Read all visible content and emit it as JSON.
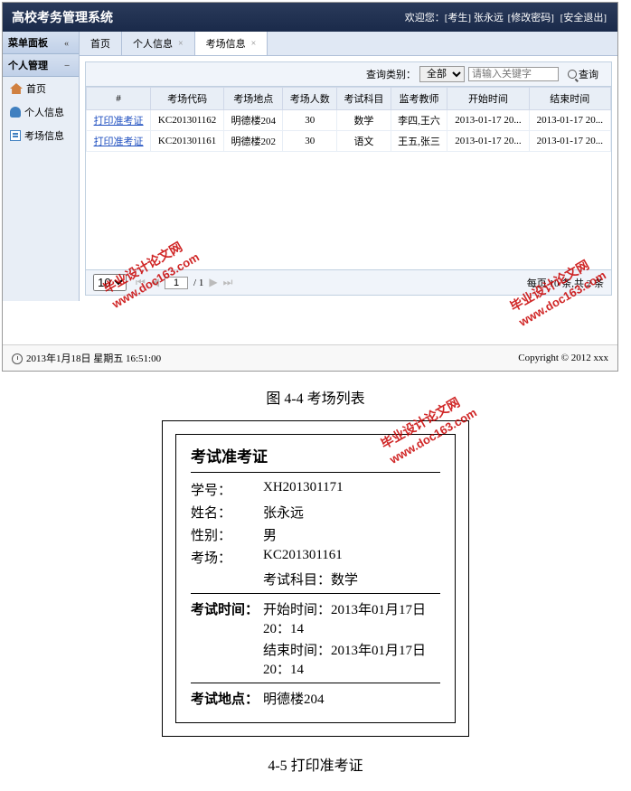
{
  "header": {
    "title": "高校考务管理系统",
    "welcome_prefix": "欢迎您：",
    "role": "[考生]",
    "username": "张永远",
    "change_pwd": "[修改密码]",
    "logout": "[安全退出]"
  },
  "sidebar": {
    "panel_title": "菜单面板",
    "group_title": "个人管理",
    "items": [
      {
        "label": "首页"
      },
      {
        "label": "个人信息"
      },
      {
        "label": "考场信息"
      }
    ]
  },
  "tabs": [
    {
      "label": "首页"
    },
    {
      "label": "个人信息"
    },
    {
      "label": "考场信息"
    }
  ],
  "search": {
    "label": "查询类别：",
    "selected": "全部",
    "placeholder": "请输入关键字",
    "btn": "查询"
  },
  "table": {
    "columns": [
      "#",
      "考场代码",
      "考场地点",
      "考场人数",
      "考试科目",
      "监考教师",
      "开始时间",
      "结束时间"
    ],
    "rows": [
      {
        "action": "打印准考证",
        "code": "KC201301162",
        "place": "明德楼204",
        "num": "30",
        "subject": "数学",
        "teacher": "李四,王六",
        "start": "2013-01-17 20...",
        "end": "2013-01-17 20..."
      },
      {
        "action": "打印准考证",
        "code": "KC201301161",
        "place": "明德楼202",
        "num": "30",
        "subject": "语文",
        "teacher": "王五,张三",
        "start": "2013-01-17 20...",
        "end": "2013-01-17 20..."
      }
    ]
  },
  "pager": {
    "size": "10",
    "page": "1",
    "total_pages": "/ 1",
    "summary": "每页 10 条,共 2 条"
  },
  "footer": {
    "datetime": "2013年1月18日 星期五 16:51:00",
    "copyright": "Copyright © 2012 xxx"
  },
  "watermark": {
    "line1": "毕业设计论文网",
    "line2": "www.doc163.com"
  },
  "caption1": "图 4-4 考场列表",
  "ticket": {
    "title": "考试准考证",
    "rows": {
      "id_label": "学号：",
      "id_val": "XH201301171",
      "name_label": "姓名：",
      "name_val": "张永远",
      "gender_label": "性别：",
      "gender_val": "男",
      "room_label": "考场：",
      "room_val": "KC201301161",
      "subject": "考试科目：数学",
      "time_label": "考试时间：",
      "start": "开始时间：2013年01月17日 20：14",
      "end": "结束时间：2013年01月17日 20：14",
      "place_label": "考试地点：",
      "place_val": "明德楼204"
    }
  },
  "caption2": "4-5 打印准考证"
}
